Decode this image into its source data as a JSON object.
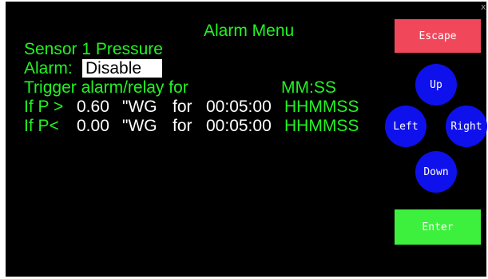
{
  "menu": {
    "title": "Alarm Menu",
    "sensor_label": "Sensor 1 Pressure",
    "alarm_label": "Alarm:",
    "alarm_value": "Disable",
    "trigger_label": "Trigger alarm/relay for",
    "trigger_format": "MM:SS",
    "rows": [
      {
        "condition": "If P >",
        "value": "0.60",
        "unit": "\"WG",
        "for_label": "for",
        "time": "00:05:00",
        "time_format": "HHMMSS"
      },
      {
        "condition": "If P<",
        "value": "0.00",
        "unit": "\"WG",
        "for_label": "for",
        "time": "00:05:00",
        "time_format": "HHMMSS"
      }
    ]
  },
  "buttons": {
    "escape": "Escape",
    "up": "Up",
    "left": "Left",
    "right": "Right",
    "down": "Down",
    "enter": "Enter"
  },
  "corner_mark": "x",
  "colors": {
    "screen_bg": "#000000",
    "label_green": "#22f322",
    "value_white": "#ffffff",
    "escape_red": "#f0475a",
    "enter_green": "#3ef03e",
    "nav_blue": "#0f11ec"
  }
}
